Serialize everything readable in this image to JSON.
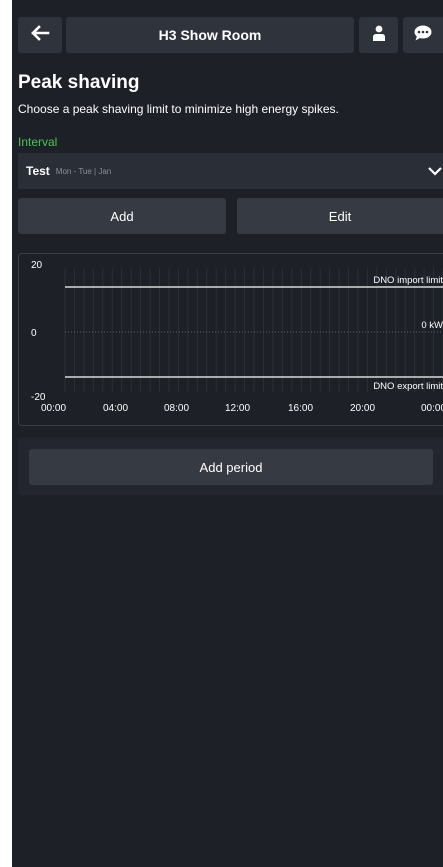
{
  "header": {
    "title": "H3 Show Room",
    "back_icon": "arrow-left-icon",
    "user_icon": "user-icon",
    "chat_icon": "chat-bubble-icon"
  },
  "page": {
    "heading": "Peak shaving",
    "subtitle": "Choose a peak shaving limit to minimize high energy spikes.",
    "interval_label": "Interval"
  },
  "interval_select": {
    "name": "Test",
    "detail": "Mon - Tue | Jan",
    "chevron_icon": "chevron-down-icon"
  },
  "actions": {
    "add_label": "Add",
    "edit_label": "Edit"
  },
  "chart_data": {
    "type": "line",
    "x_tick_labels": [
      "00:00",
      "04:00",
      "08:00",
      "12:00",
      "16:00",
      "20:00",
      "00:00"
    ],
    "y_tick_labels": [
      "20",
      "0",
      "-20"
    ],
    "ylim": [
      -20,
      20
    ],
    "grid": true,
    "series": [
      {
        "name": "DNO import limit",
        "values": [
          15,
          15
        ],
        "color": "#d9d9d9"
      },
      {
        "name": "DNO export limit",
        "values": [
          -15,
          -15
        ],
        "color": "#d9d9d9"
      }
    ],
    "annotations": [
      {
        "text": "DNO import limit",
        "y": 15
      },
      {
        "text": "0 kW",
        "y": 0
      },
      {
        "text": "DNO export limit",
        "y": -15
      }
    ]
  },
  "period": {
    "add_period_label": "Add period"
  }
}
